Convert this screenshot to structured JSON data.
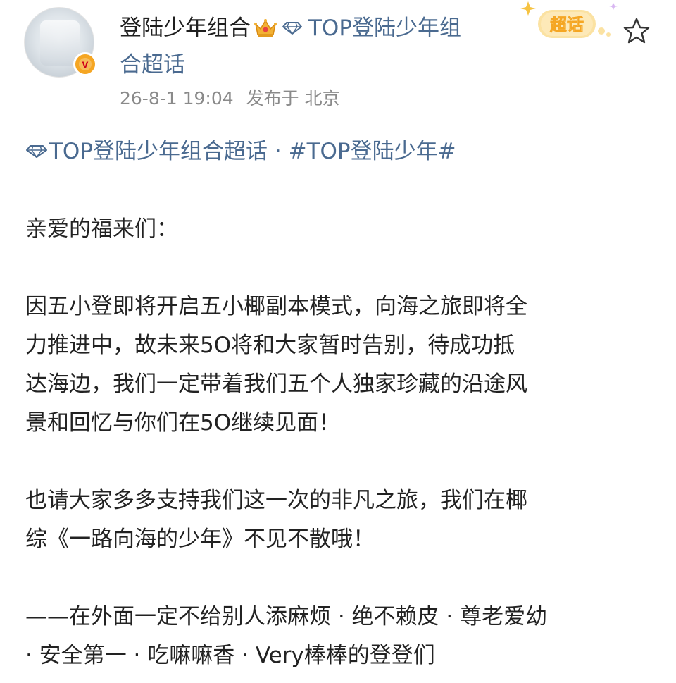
{
  "author": {
    "name": "登陆少年组合",
    "topic_line1": "TOP登陆少年组",
    "topic_line2": "合超话",
    "avatar_badge": "v"
  },
  "meta": {
    "timestamp": "26-8-1 19:04",
    "location": "发布于 北京"
  },
  "badge": {
    "label": "超话"
  },
  "post": {
    "topic_link": "TOP登陆少年组合超话",
    "topic_sep": " · ",
    "hashtag": "#TOP登陆少年#",
    "greeting": "亲爱的福来们：",
    "paragraph1": [
      "因五小登即将开启五小椰副本模式，向海之旅即将全",
      "力推进中，故未来5O将和大家暂时告别，待成功抵",
      "达海边，我们一定带着我们五个人独家珍藏的沿途风",
      "景和回忆与你们在5O继续见面！"
    ],
    "paragraph2": [
      "也请大家多多支持我们这一次的非凡之旅，我们在椰",
      "综《一路向海的少年》不见不散哦！"
    ],
    "closing": [
      "——在外面一定不给别人添麻烦 · 绝不赖皮 · 尊老爱幼",
      " · 安全第一 · 吃嘛嘛香 · Very棒棒的登登们"
    ]
  },
  "colors": {
    "link": "#4a6a90",
    "meta": "#8a8a8a",
    "badge_orange": "#f5a623"
  }
}
